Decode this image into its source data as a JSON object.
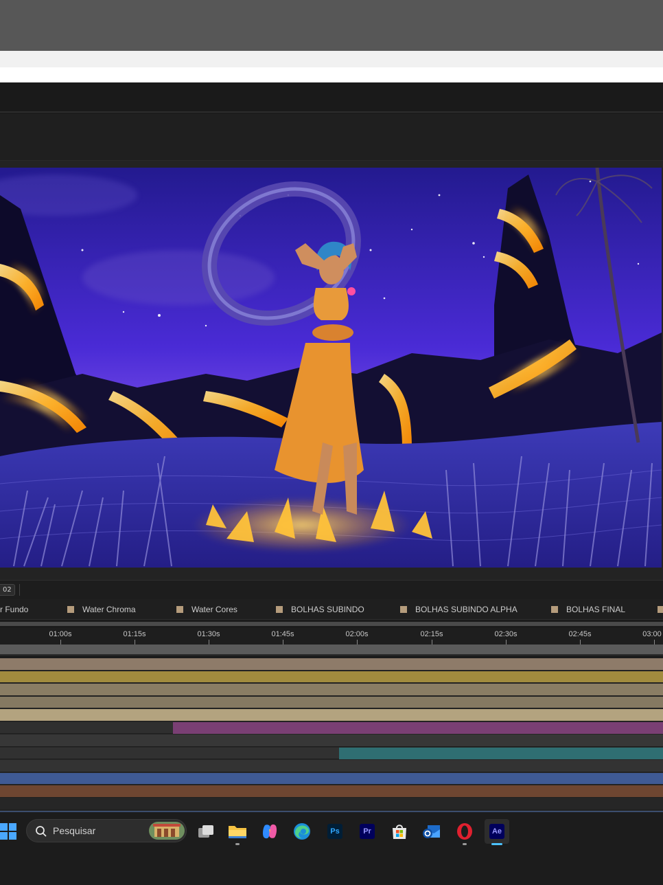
{
  "viewer": {
    "resolution_chip": "02"
  },
  "timeline": {
    "comp_tabs": [
      {
        "label": "r Fundo",
        "swatch": ""
      },
      {
        "label": "Water Chroma",
        "swatch": "#b59c7c"
      },
      {
        "label": "Water Cores",
        "swatch": "#b59c7c"
      },
      {
        "label": "BOLHAS SUBINDO",
        "swatch": "#b59c7c"
      },
      {
        "label": "BOLHAS SUBINDO ALPHA",
        "swatch": "#b59c7c"
      },
      {
        "label": "BOLHAS FINAL",
        "swatch": "#b59c7c"
      }
    ],
    "time_ticks": [
      "01:00s",
      "01:15s",
      "01:30s",
      "01:45s",
      "02:00s",
      "02:15s",
      "02:30s",
      "02:45s",
      "03:00"
    ],
    "tracks": [
      {
        "color": "#8e7b69"
      },
      {
        "color": "#a18b3e"
      },
      {
        "color": "#8a7d64"
      },
      {
        "color": "#857962"
      },
      {
        "color": "#b3a37f"
      },
      {
        "color": "#7a3f74",
        "start_time": "01:37s"
      },
      {
        "color": "#373737"
      },
      {
        "color": "#2f6e72",
        "start_time": "02:04s"
      },
      {
        "color": "#333333"
      },
      {
        "color": "#3f5a94"
      },
      {
        "color": "#6e4631"
      },
      {
        "color": "#262626"
      }
    ]
  },
  "taskbar": {
    "search_placeholder": "Pesquisar",
    "apps": [
      {
        "name": "task-view",
        "label": ""
      },
      {
        "name": "file-explorer",
        "label": ""
      },
      {
        "name": "copilot",
        "label": ""
      },
      {
        "name": "edge",
        "label": ""
      },
      {
        "name": "photoshop",
        "label": "Ps"
      },
      {
        "name": "premiere-pro",
        "label": "Pr"
      },
      {
        "name": "microsoft-store",
        "label": ""
      },
      {
        "name": "outlook",
        "label": ""
      },
      {
        "name": "opera",
        "label": ""
      },
      {
        "name": "after-effects",
        "label": "Ae"
      }
    ]
  },
  "colors": {
    "ps": "#31a8ff",
    "pr": "#9999ff",
    "ae": "#9999ff",
    "accent": "#4cc2ff"
  }
}
